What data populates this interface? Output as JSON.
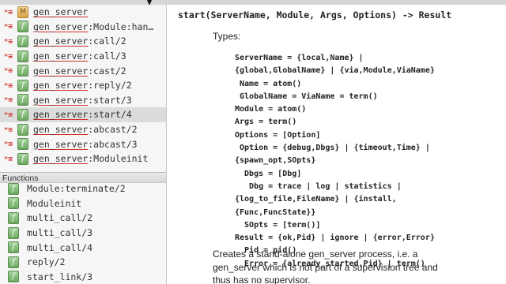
{
  "left_panel": {
    "modules": [
      {
        "icon": "module-icon",
        "label": "gen_server",
        "selected": false
      },
      {
        "icon": "function-icon",
        "label": "gen_server:Module:han…",
        "selected": false
      },
      {
        "icon": "function-icon",
        "label": "gen_server:call/2",
        "selected": false
      },
      {
        "icon": "function-icon",
        "label": "gen_server:call/3",
        "selected": false
      },
      {
        "icon": "function-icon",
        "label": "gen_server:cast/2",
        "selected": false
      },
      {
        "icon": "function-icon",
        "label": "gen_server:reply/2",
        "selected": false
      },
      {
        "icon": "function-icon",
        "label": "gen_server:start/3",
        "selected": false
      },
      {
        "icon": "function-icon",
        "label": "gen_server:start/4",
        "selected": true
      },
      {
        "icon": "function-icon",
        "label": "gen_server:abcast/2",
        "selected": false
      },
      {
        "icon": "function-icon",
        "label": "gen_server:abcast/3",
        "selected": false
      },
      {
        "icon": "function-icon",
        "label": "gen_server:Moduleinit",
        "selected": false
      }
    ],
    "functions_header": "Functions",
    "functions": [
      {
        "icon": "function-icon",
        "label": "Module:terminate/2"
      },
      {
        "icon": "function-icon",
        "label": "Moduleinit"
      },
      {
        "icon": "function-icon",
        "label": "multi_call/2"
      },
      {
        "icon": "function-icon",
        "label": "multi_call/3"
      },
      {
        "icon": "function-icon",
        "label": "multi_call/4"
      },
      {
        "icon": "function-icon",
        "label": "reply/2"
      },
      {
        "icon": "function-icon",
        "label": "start_link/3"
      }
    ]
  },
  "doc": {
    "signature": "start(ServerName, Module, Args, Options) -> Result",
    "types_heading": "Types:",
    "type_lines": [
      "ServerName = {local,Name} |",
      "{global,GlobalName} | {via,Module,ViaName}",
      " Name = atom()",
      " GlobalName = ViaName = term()",
      "Module = atom()",
      "Args = term()",
      "Options = [Option]",
      " Option = {debug,Dbgs} | {timeout,Time} |",
      "{spawn_opt,SOpts}",
      "  Dbgs = [Dbg]",
      "   Dbg = trace | log | statistics |",
      "{log_to_file,FileName} | {install,",
      "{Func,FuncState}}",
      "  SOpts = [term()]",
      "Result = {ok,Pid} | ignore | {error,Error}",
      "  Pid = pid()",
      "  Error = {already_started,Pid} | term()"
    ],
    "description_lines": [
      "Creates a stand-alone gen_server process, i.e. a",
      "gen_server which is not part of a supervision tree and",
      "thus has no supervisor."
    ]
  }
}
